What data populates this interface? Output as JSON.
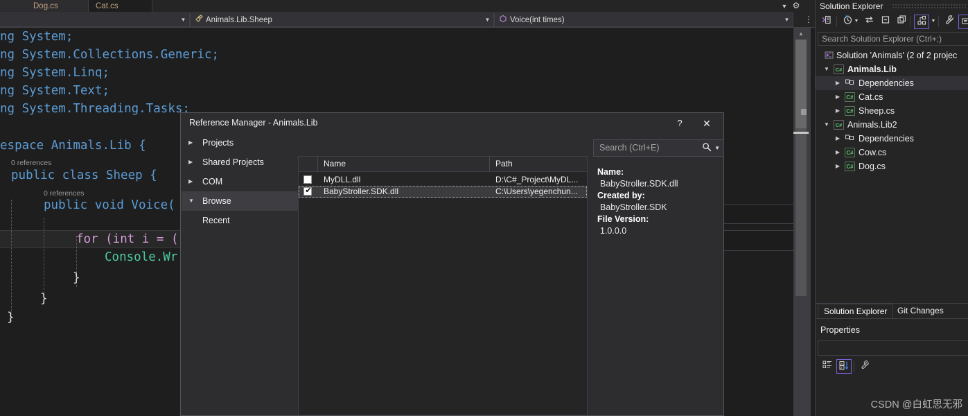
{
  "editor": {
    "tabs": [
      {
        "label": "Dog.cs",
        "active": false
      },
      {
        "label": "Cat.cs",
        "active": true
      }
    ],
    "nav": {
      "scope_label": "",
      "type_label": "Animals.Lib.Sheep",
      "member_label": "Voice(int times)"
    },
    "code_lines": [
      {
        "text": "ng System;"
      },
      {
        "text": "ng System.Collections.Generic;"
      },
      {
        "text": "ng System.Linq;"
      },
      {
        "text": "ng System.Text;"
      },
      {
        "text": "ng System.Threading.Tasks;"
      },
      {
        "text": "espace Animals.Lib {"
      },
      {
        "text": "public class Sheep {"
      },
      {
        "text": "public void Voice("
      },
      {
        "text": "for (int i = ("
      },
      {
        "text": "Console.Wr"
      },
      {
        "text": "}"
      },
      {
        "text": "}"
      },
      {
        "text": "}"
      }
    ],
    "codelens": [
      {
        "text": "0 references"
      },
      {
        "text": "0 references"
      }
    ]
  },
  "dialog": {
    "title": "Reference Manager - Animals.Lib",
    "help_label": "?",
    "close_label": "✕",
    "nav_items": [
      {
        "label": "Projects",
        "expanded": false,
        "selected": false
      },
      {
        "label": "Shared Projects",
        "expanded": false,
        "selected": false
      },
      {
        "label": "COM",
        "expanded": false,
        "selected": false
      },
      {
        "label": "Browse",
        "expanded": true,
        "selected": true
      }
    ],
    "nav_sub_items": [
      {
        "label": "Recent"
      }
    ],
    "list": {
      "columns": [
        "Name",
        "Path"
      ],
      "rows": [
        {
          "checked": false,
          "name": "MyDLL.dll",
          "path": "D:\\C#_Project\\MyDL...",
          "selected": false
        },
        {
          "checked": true,
          "name": "BabyStroller.SDK.dll",
          "path": "C:\\Users\\yegenchun...",
          "selected": true
        }
      ]
    },
    "search_placeholder": "Search (Ctrl+E)",
    "details": [
      {
        "label": "Name:",
        "value": "BabyStroller.SDK.dll"
      },
      {
        "label": "Created by:",
        "value": "BabyStroller.SDK"
      },
      {
        "label": "File Version:",
        "value": "1.0.0.0"
      }
    ]
  },
  "solution_explorer": {
    "title": "Solution Explorer",
    "search_placeholder": "Search Solution Explorer (Ctrl+;)",
    "tree": [
      {
        "label": "Solution 'Animals' (2 of 2 projec",
        "depth": 0,
        "icon": "solution-icon",
        "tri": "",
        "bold": false,
        "highlight": false
      },
      {
        "label": "Animals.Lib",
        "depth": 1,
        "icon": "csharp-project-icon",
        "tri": "◢",
        "bold": true,
        "highlight": false
      },
      {
        "label": "Dependencies",
        "depth": 2,
        "icon": "dependencies-icon",
        "tri": "▸",
        "bold": false,
        "highlight": true
      },
      {
        "label": "Cat.cs",
        "depth": 2,
        "icon": "csharp-file-icon",
        "tri": "▸",
        "bold": false,
        "highlight": false
      },
      {
        "label": "Sheep.cs",
        "depth": 2,
        "icon": "csharp-file-icon",
        "tri": "▸",
        "bold": false,
        "highlight": false
      },
      {
        "label": "Animals.Lib2",
        "depth": 1,
        "icon": "csharp-project-icon",
        "tri": "◢",
        "bold": false,
        "highlight": false
      },
      {
        "label": "Dependencies",
        "depth": 2,
        "icon": "dependencies-icon",
        "tri": "▸",
        "bold": false,
        "highlight": false
      },
      {
        "label": "Cow.cs",
        "depth": 2,
        "icon": "csharp-file-icon",
        "tri": "▸",
        "bold": false,
        "highlight": false
      },
      {
        "label": "Dog.cs",
        "depth": 2,
        "icon": "csharp-file-icon",
        "tri": "▸",
        "bold": false,
        "highlight": false
      }
    ]
  },
  "dock_tabs": [
    {
      "label": "Solution Explorer",
      "active": true
    },
    {
      "label": "Git Changes",
      "active": false
    }
  ],
  "properties": {
    "title": "Properties"
  },
  "watermark": "CSDN @白虹思无邪",
  "colors": {
    "accent_purple": "#7b5fd6",
    "chrome_bg": "#252526",
    "editor_bg": "#1e1e1e",
    "dialog_bg": "#2d2d30",
    "tab_text": "#c0a080",
    "keyword": "#5c9cd6",
    "type": "#4ec9a0",
    "method": "#dcdcaa",
    "control_keyword": "#d69dd6"
  }
}
